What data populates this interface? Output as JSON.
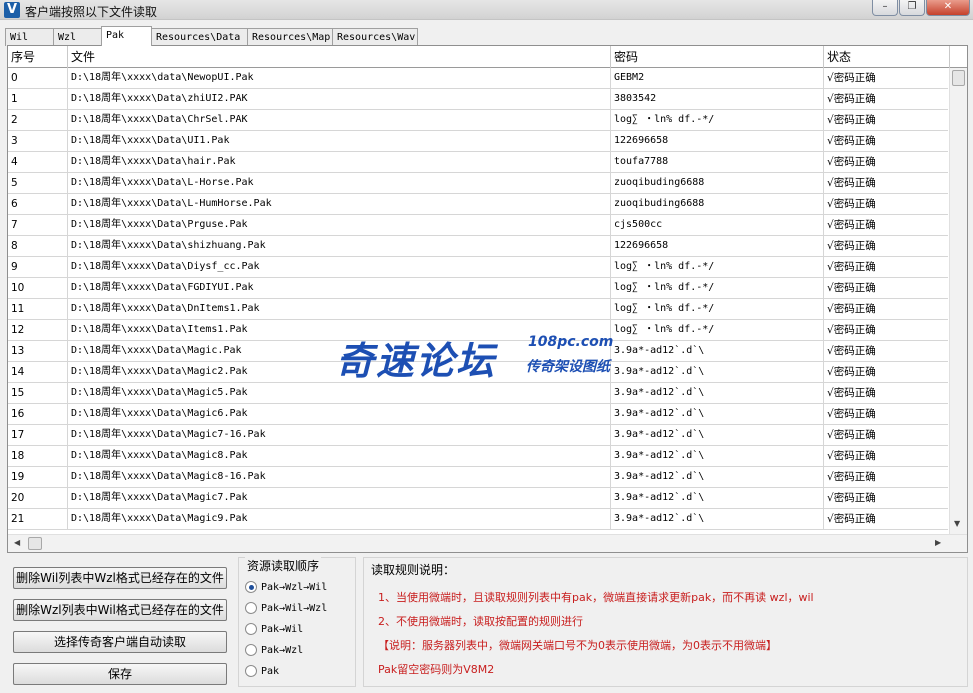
{
  "window": {
    "title": "客户端按照以下文件读取",
    "icon_letter": "V",
    "minimize": "–",
    "restore": "❐",
    "close": "✕"
  },
  "tabs": [
    {
      "label": "Wil",
      "active": false
    },
    {
      "label": "Wzl",
      "active": false
    },
    {
      "label": "Pak",
      "active": true
    },
    {
      "label": "Resources\\Data",
      "active": false
    },
    {
      "label": "Resources\\Map",
      "active": false
    },
    {
      "label": "Resources\\Wav",
      "active": false
    }
  ],
  "table": {
    "headers": [
      "序号",
      "文件",
      "密码",
      "状态"
    ],
    "rows": [
      [
        "0",
        "D:\\18周年\\xxxx\\data\\NewopUI.Pak",
        "GEBM2",
        "√密码正确"
      ],
      [
        "1",
        "D:\\18周年\\xxxx\\Data\\zhiUI2.PAK",
        "3803542",
        "√密码正确"
      ],
      [
        "2",
        "D:\\18周年\\xxxx\\Data\\ChrSel.PAK",
        "log∑ ・ln% df.-*/",
        "√密码正确"
      ],
      [
        "3",
        "D:\\18周年\\xxxx\\Data\\UI1.Pak",
        "122696658",
        "√密码正确"
      ],
      [
        "4",
        "D:\\18周年\\xxxx\\Data\\hair.Pak",
        "toufa7788",
        "√密码正确"
      ],
      [
        "5",
        "D:\\18周年\\xxxx\\Data\\L-Horse.Pak",
        "zuoqibuding6688",
        "√密码正确"
      ],
      [
        "6",
        "D:\\18周年\\xxxx\\Data\\L-HumHorse.Pak",
        "zuoqibuding6688",
        "√密码正确"
      ],
      [
        "7",
        "D:\\18周年\\xxxx\\Data\\Prguse.Pak",
        "cjs500cc",
        "√密码正确"
      ],
      [
        "8",
        "D:\\18周年\\xxxx\\Data\\shizhuang.Pak",
        "122696658",
        "√密码正确"
      ],
      [
        "9",
        "D:\\18周年\\xxxx\\Data\\Diysf_cc.Pak",
        "log∑ ・ln% df.-*/",
        "√密码正确"
      ],
      [
        "10",
        "D:\\18周年\\xxxx\\Data\\FGDIYUI.Pak",
        "log∑ ・ln% df.-*/",
        "√密码正确"
      ],
      [
        "11",
        "D:\\18周年\\xxxx\\Data\\DnItems1.Pak",
        "log∑ ・ln% df.-*/",
        "√密码正确"
      ],
      [
        "12",
        "D:\\18周年\\xxxx\\Data\\Items1.Pak",
        "log∑ ・ln% df.-*/",
        "√密码正确"
      ],
      [
        "13",
        "D:\\18周年\\xxxx\\Data\\Magic.Pak",
        "3.9a*-ad12`.d`\\",
        "√密码正确"
      ],
      [
        "14",
        "D:\\18周年\\xxxx\\Data\\Magic2.Pak",
        "3.9a*-ad12`.d`\\",
        "√密码正确"
      ],
      [
        "15",
        "D:\\18周年\\xxxx\\Data\\Magic5.Pak",
        "3.9a*-ad12`.d`\\",
        "√密码正确"
      ],
      [
        "16",
        "D:\\18周年\\xxxx\\Data\\Magic6.Pak",
        "3.9a*-ad12`.d`\\",
        "√密码正确"
      ],
      [
        "17",
        "D:\\18周年\\xxxx\\Data\\Magic7-16.Pak",
        "3.9a*-ad12`.d`\\",
        "√密码正确"
      ],
      [
        "18",
        "D:\\18周年\\xxxx\\Data\\Magic8.Pak",
        "3.9a*-ad12`.d`\\",
        "√密码正确"
      ],
      [
        "19",
        "D:\\18周年\\xxxx\\Data\\Magic8-16.Pak",
        "3.9a*-ad12`.d`\\",
        "√密码正确"
      ],
      [
        "20",
        "D:\\18周年\\xxxx\\Data\\Magic7.Pak",
        "3.9a*-ad12`.d`\\",
        "√密码正确"
      ],
      [
        "21",
        "D:\\18周年\\xxxx\\Data\\Magic9.Pak",
        "3.9a*-ad12`.d`\\",
        "√密码正确"
      ]
    ]
  },
  "watermark": {
    "main": "奇速论坛",
    "url": "108pc.com",
    "sub": "传奇架设图纸"
  },
  "buttons": {
    "delete_wil": "删除Wil列表中Wzl格式已经存在的文件",
    "delete_wzl": "删除Wzl列表中Wil格式已经存在的文件",
    "select_client": "选择传奇客户端自动读取",
    "save": "保存"
  },
  "read_order": {
    "title": "资源读取顺序",
    "options": [
      {
        "label": "Pak→Wzl→Wil",
        "selected": true
      },
      {
        "label": "Pak→Wil→Wzl",
        "selected": false
      },
      {
        "label": "Pak→Wil",
        "selected": false
      },
      {
        "label": "Pak→Wzl",
        "selected": false
      },
      {
        "label": "Pak",
        "selected": false
      }
    ]
  },
  "rules": {
    "title": "读取规则说明：",
    "lines": [
      "1、当使用微端时，且读取规则列表中有pak，微端直接请求更新pak，而不再读 wzl，wil",
      "2、不使用微端时，读取按配置的规则进行",
      "【说明：服务器列表中，微端网关端口号不为0表示使用微端，为0表示不用微端】",
      "Pak留空密码则为V8M2"
    ]
  },
  "colors": {
    "rule_text": "#c81e1e",
    "watermark": "#1d4fb3"
  }
}
